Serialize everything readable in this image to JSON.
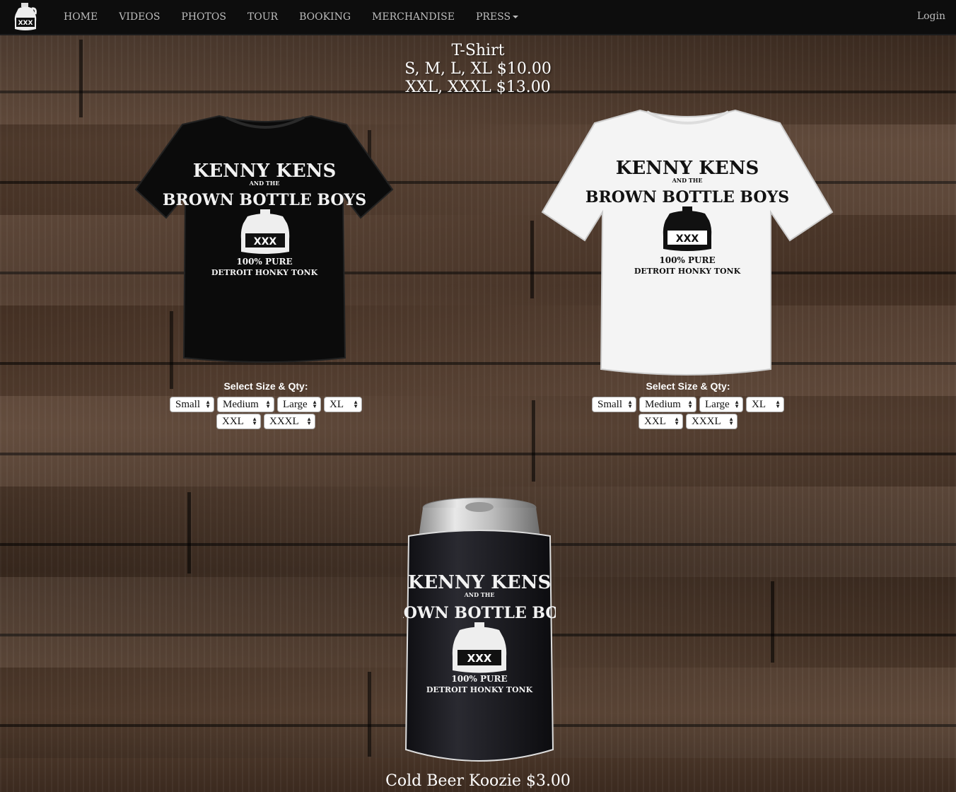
{
  "nav": {
    "brand_icon": "jug-logo-icon",
    "items": [
      "HOME",
      "VIDEOS",
      "PHOTOS",
      "TOUR",
      "BOOKING",
      "MERCHANDISE",
      "PRESS"
    ],
    "login": "Login"
  },
  "tshirt": {
    "title": "T-Shirt",
    "price_line1": "S, M, L, XL $10.00",
    "price_line2": "XXL, XXXL $13.00",
    "print": {
      "line1": "KENNY KENS",
      "line2": "AND THE",
      "line3": "BROWN BOTTLE BOYS",
      "jug": "XXX",
      "line4": "100% PURE",
      "line5": "DETROIT HONKY TONK"
    },
    "products": [
      {
        "color": "#0b0b0b",
        "select_label": "Select Size & Qty:",
        "sizes": [
          "Small",
          "Medium",
          "Large",
          "XL",
          "XXL",
          "XXXL"
        ]
      },
      {
        "color": "#f4f4f4",
        "select_label": "Select Size & Qty:",
        "sizes": [
          "Small",
          "Medium",
          "Large",
          "XL",
          "XXL",
          "XXXL"
        ]
      }
    ]
  },
  "koozie": {
    "title": "Cold Beer Koozie $3.00",
    "color": "#1a1a1f"
  }
}
